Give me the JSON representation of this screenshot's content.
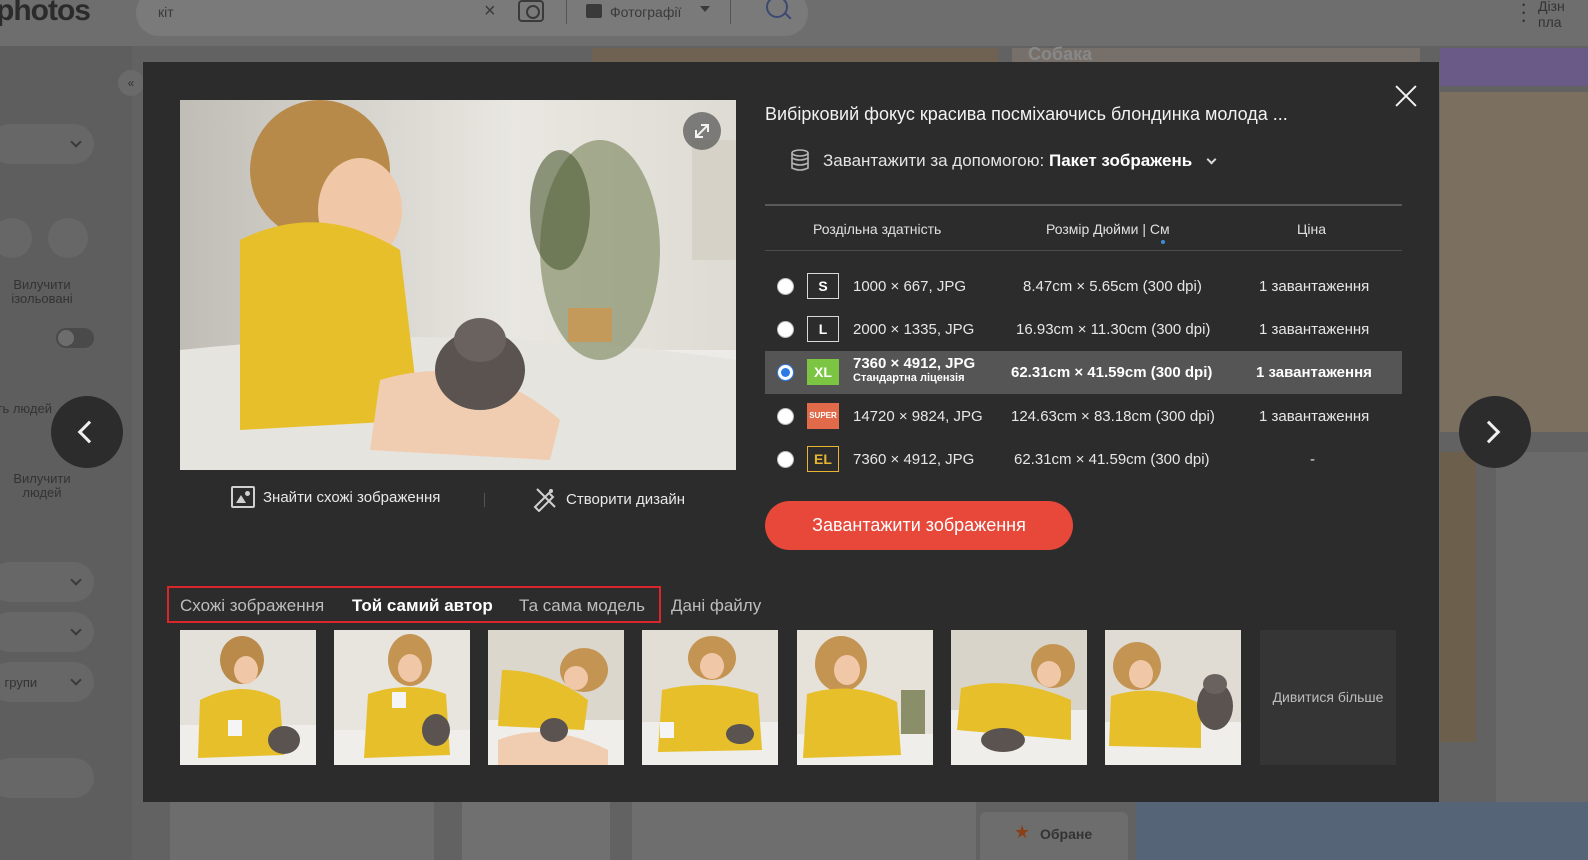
{
  "background": {
    "logo": "photos",
    "search_value": "кіт",
    "search_clear": "×",
    "filter_label": "Фотографії",
    "right_text": "Дізн\nпла",
    "sidebar_exclude_isolated": "Вилучити ізольовані",
    "sidebar_people_count": "сть людей",
    "sidebar_exclude_people": "Вилучити людей",
    "sidebar_groups": "і групи",
    "tile_dog": "Собака",
    "favorites": "Обране",
    "collapse_icon": "«"
  },
  "modal": {
    "title": "Вибірковий фокус красива посміхаючись блондинка молода ...",
    "download_via_label": "Завантажити за допомогою:",
    "download_via_value": "Пакет зображень",
    "tools": {
      "find_similar": "Знайти схожі зображення",
      "create_design": "Створити дизайн"
    },
    "table": {
      "headers": {
        "resolution": "Роздільна здатність",
        "size": "Розмір Дюйми | См",
        "price": "Ціна"
      },
      "rows": [
        {
          "badge": "S",
          "resolution": "1000 × 667, JPG",
          "license": "",
          "size": "8.47cm × 5.65cm (300 dpi)",
          "price": "1 завантаження"
        },
        {
          "badge": "L",
          "resolution": "2000 × 1335, JPG",
          "license": "",
          "size": "16.93cm × 11.30cm (300 dpi)",
          "price": "1 завантаження"
        },
        {
          "badge": "XL",
          "resolution": "7360 × 4912, JPG",
          "license": "Стандартна ліцензія",
          "size": "62.31cm × 41.59cm (300 dpi)",
          "price": "1 завантаження"
        },
        {
          "badge": "SUPER",
          "resolution": "14720 × 9824, JPG",
          "license": "",
          "size": "124.63cm × 83.18cm (300 dpi)",
          "price": "1 завантаження"
        },
        {
          "badge": "EL",
          "resolution": "7360 × 4912, JPG",
          "license": "",
          "size": "62.31cm × 41.59cm (300 dpi)",
          "price": "-"
        }
      ],
      "selected_row": 2
    },
    "download_button": "Завантажити зображення",
    "tabs": [
      "Схожі зображення",
      "Той самий автор",
      "Та сама модель",
      "Дані файлу"
    ],
    "active_tab": "Той самий автор",
    "see_more": "Дивитися більше",
    "colors": {
      "accent_red": "#e7483a",
      "highlight_outline": "#d9262a",
      "modal_bg": "#2c2c2c",
      "selected_row": "#555555",
      "xl_badge": "#7bc543",
      "super_badge": "#e06a4a",
      "el_badge": "#e8b530",
      "radio_selected": "#2c7be5"
    },
    "icons": [
      "close-icon",
      "expand-icon",
      "image-search-icon",
      "design-tools-icon",
      "coins-stack-icon",
      "chevron-down-icon",
      "chevron-left-icon",
      "chevron-right-icon"
    ]
  }
}
